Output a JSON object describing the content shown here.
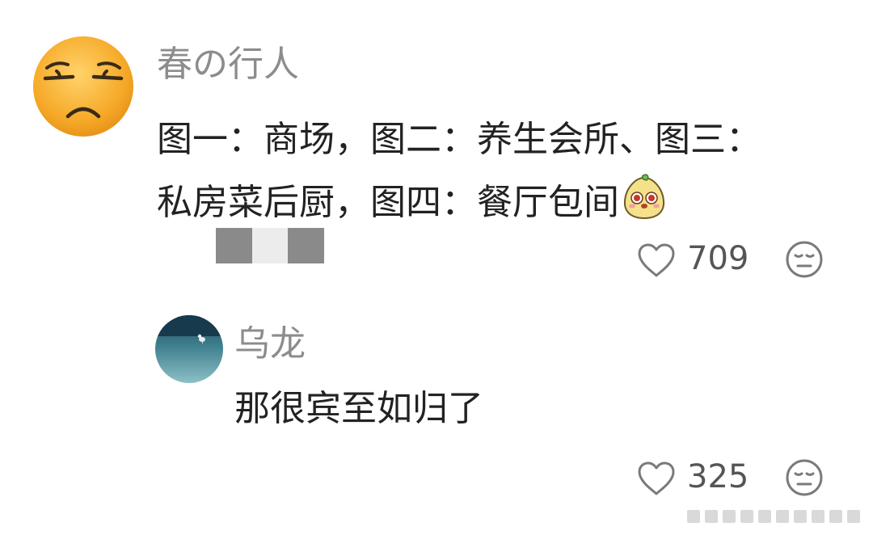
{
  "comment": {
    "username": "春の行人",
    "text_line1": "图一：商场，图二：养生会所、图三：",
    "text_line2": "私房菜后厨，图四：餐厅包间",
    "likes": "709",
    "avatar_icon": "unamused-face-emoji",
    "inline_icon": "pear-character-emoji",
    "redaction_colors": [
      "#8a8a8a",
      "#ececec",
      "#8a8a8a"
    ]
  },
  "reply": {
    "username": "乌龙",
    "text": "那很宾至如归了",
    "likes": "325",
    "avatar_icon": "seagull-on-pavement-photo"
  },
  "icons": {
    "like": "heart-outline-icon",
    "reaction": "neutral-face-icon"
  },
  "colors": {
    "username": "#8c8c8c",
    "text": "#222222",
    "icon": "#7a7a7a"
  }
}
